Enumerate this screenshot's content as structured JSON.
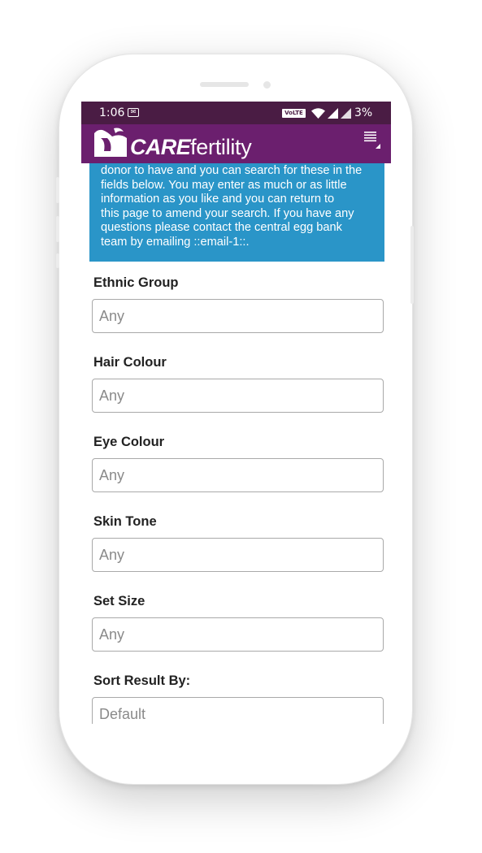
{
  "status_bar": {
    "time": "1:06",
    "notification_icon": "app-notification-icon",
    "network_label": "VoLTE 1",
    "wifi_icon": "wifi-icon",
    "signal_icon": "signal-icon",
    "battery": "3%"
  },
  "app_bar": {
    "logo_bold": "CARE",
    "logo_light": "fertility",
    "menu_icon": "menu-icon"
  },
  "intro": {
    "lines": [
      "donor to have and you can search for these in the",
      "fields below. You may enter as much or as little",
      "information as you like and you can return to",
      "this page to amend your search.  If you have any",
      "questions please contact the central egg bank",
      "team by emailing ::email-1::."
    ]
  },
  "form": {
    "fields": [
      {
        "label": "Ethnic Group",
        "value": "Any"
      },
      {
        "label": "Hair Colour",
        "value": "Any"
      },
      {
        "label": "Eye Colour",
        "value": "Any"
      },
      {
        "label": "Skin Tone",
        "value": "Any"
      },
      {
        "label": "Set Size",
        "value": "Any"
      },
      {
        "label": "Sort Result By:",
        "value": "Default"
      }
    ]
  },
  "colors": {
    "status_bar": "#4a1c44",
    "brand_purple": "#6b1f6e",
    "info_blue": "#2a95c8"
  }
}
